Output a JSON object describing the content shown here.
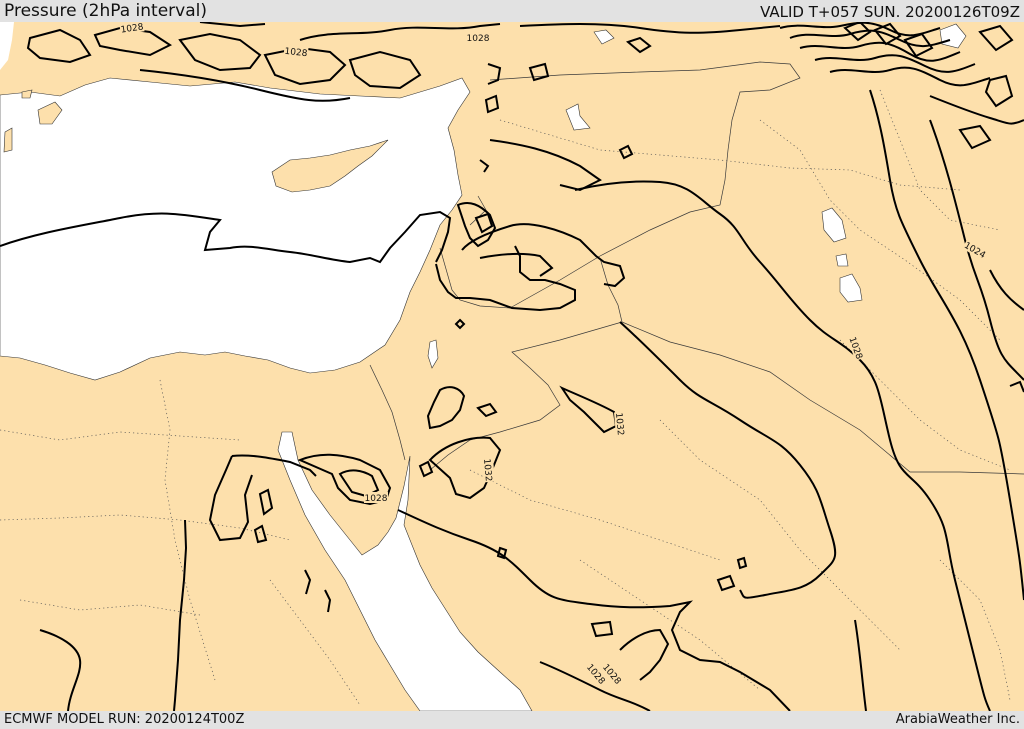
{
  "header": {
    "title": "Pressure (2hPa interval)",
    "valid": "VALID T+057 SUN. 20200126T09Z"
  },
  "footer": {
    "model_run": "ECMWF MODEL RUN: 20200124T00Z",
    "credit": "ArabiaWeather Inc."
  },
  "colors": {
    "land": "#fde0ac",
    "sea": "#ffffff",
    "isobar": "#000000",
    "border": "#3a3a3a",
    "bar_bg": "#e2e2e2"
  },
  "isobar_labels": [
    "1028",
    "1028",
    "1028",
    "1028",
    "1032",
    "1032",
    "1028",
    "1028",
    "1028",
    "1024"
  ]
}
